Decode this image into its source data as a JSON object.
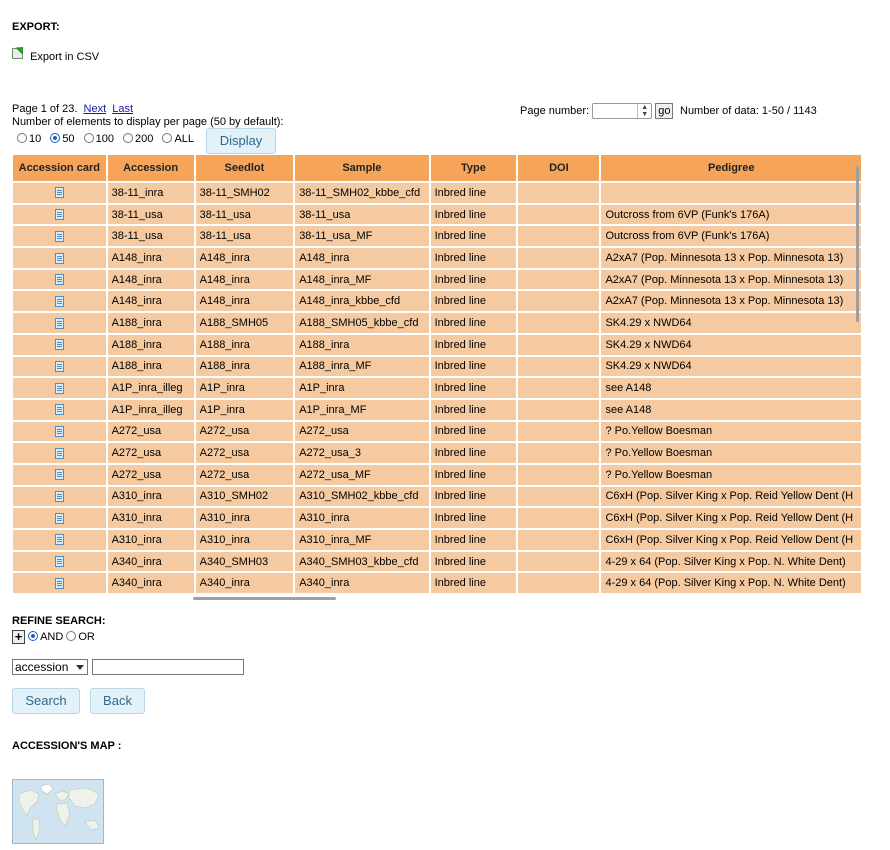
{
  "export": {
    "heading": "EXPORT:",
    "csv_label": "Export in CSV"
  },
  "pagination": {
    "page_info": "Page 1 of 23.",
    "next": "Next",
    "last": "Last",
    "per_page_text": "Number of elements to display per page (50 by default):",
    "page_number_label": "Page number:",
    "go_label": "go",
    "data_count": "Number of data: 1-50 / 1143",
    "options": [
      "10",
      "50",
      "100",
      "200",
      "ALL"
    ],
    "selected_option": "50",
    "display_label": "Display"
  },
  "table": {
    "columns": [
      "Accession card",
      "Accession",
      "Seedlot",
      "Sample",
      "Type",
      "DOI",
      "Pedigree"
    ],
    "rows": [
      [
        "38-11_inra",
        "38-11_SMH02",
        "38-11_SMH02_kbbe_cfd",
        "Inbred line",
        "",
        ""
      ],
      [
        "38-11_usa",
        "38-11_usa",
        "38-11_usa",
        "Inbred line",
        "",
        "Outcross from 6VP (Funk's 176A)"
      ],
      [
        "38-11_usa",
        "38-11_usa",
        "38-11_usa_MF",
        "Inbred line",
        "",
        "Outcross from 6VP (Funk's 176A)"
      ],
      [
        "A148_inra",
        "A148_inra",
        "A148_inra",
        "Inbred line",
        "",
        "A2xA7 (Pop. Minnesota 13 x Pop. Minnesota 13)"
      ],
      [
        "A148_inra",
        "A148_inra",
        "A148_inra_MF",
        "Inbred line",
        "",
        "A2xA7 (Pop. Minnesota 13 x Pop. Minnesota 13)"
      ],
      [
        "A148_inra",
        "A148_inra",
        "A148_inra_kbbe_cfd",
        "Inbred line",
        "",
        "A2xA7 (Pop. Minnesota 13 x Pop. Minnesota 13)"
      ],
      [
        "A188_inra",
        "A188_SMH05",
        "A188_SMH05_kbbe_cfd",
        "Inbred line",
        "",
        "SK4.29 x NWD64"
      ],
      [
        "A188_inra",
        "A188_inra",
        "A188_inra",
        "Inbred line",
        "",
        "SK4.29 x NWD64"
      ],
      [
        "A188_inra",
        "A188_inra",
        "A188_inra_MF",
        "Inbred line",
        "",
        "SK4.29 x NWD64"
      ],
      [
        "A1P_inra_illeg",
        "A1P_inra",
        "A1P_inra",
        "Inbred line",
        "",
        "see A148"
      ],
      [
        "A1P_inra_illeg",
        "A1P_inra",
        "A1P_inra_MF",
        "Inbred line",
        "",
        "see A148"
      ],
      [
        "A272_usa",
        "A272_usa",
        "A272_usa",
        "Inbred line",
        "",
        "? Po.Yellow Boesman"
      ],
      [
        "A272_usa",
        "A272_usa",
        "A272_usa_3",
        "Inbred line",
        "",
        "? Po.Yellow Boesman"
      ],
      [
        "A272_usa",
        "A272_usa",
        "A272_usa_MF",
        "Inbred line",
        "",
        "? Po.Yellow Boesman"
      ],
      [
        "A310_inra",
        "A310_SMH02",
        "A310_SMH02_kbbe_cfd",
        "Inbred line",
        "",
        "C6xH (Pop. Silver King x Pop. Reid Yellow Dent (H"
      ],
      [
        "A310_inra",
        "A310_inra",
        "A310_inra",
        "Inbred line",
        "",
        "C6xH (Pop. Silver King x Pop. Reid Yellow Dent (H"
      ],
      [
        "A310_inra",
        "A310_inra",
        "A310_inra_MF",
        "Inbred line",
        "",
        "C6xH (Pop. Silver King x Pop. Reid Yellow Dent (H"
      ],
      [
        "A340_inra",
        "A340_SMH03",
        "A340_SMH03_kbbe_cfd",
        "Inbred line",
        "",
        "4-29 x 64 (Pop. Silver King x Pop. N. White Dent)"
      ],
      [
        "A340_inra",
        "A340_inra",
        "A340_inra",
        "Inbred line",
        "",
        "4-29 x 64 (Pop. Silver King x Pop. N. White Dent)"
      ]
    ]
  },
  "refine": {
    "heading": "REFINE SEARCH:",
    "plus": "+",
    "and_label": "AND",
    "or_label": "OR",
    "field_select": "accession",
    "search_label": "Search",
    "back_label": "Back"
  },
  "map": {
    "heading": "ACCESSION'S MAP :"
  },
  "colors": {
    "header_bg": "#f5a45a",
    "cell_bg": "#f6caa0",
    "button_bg": "#e3f1f8",
    "link": "#1a1aa6"
  }
}
